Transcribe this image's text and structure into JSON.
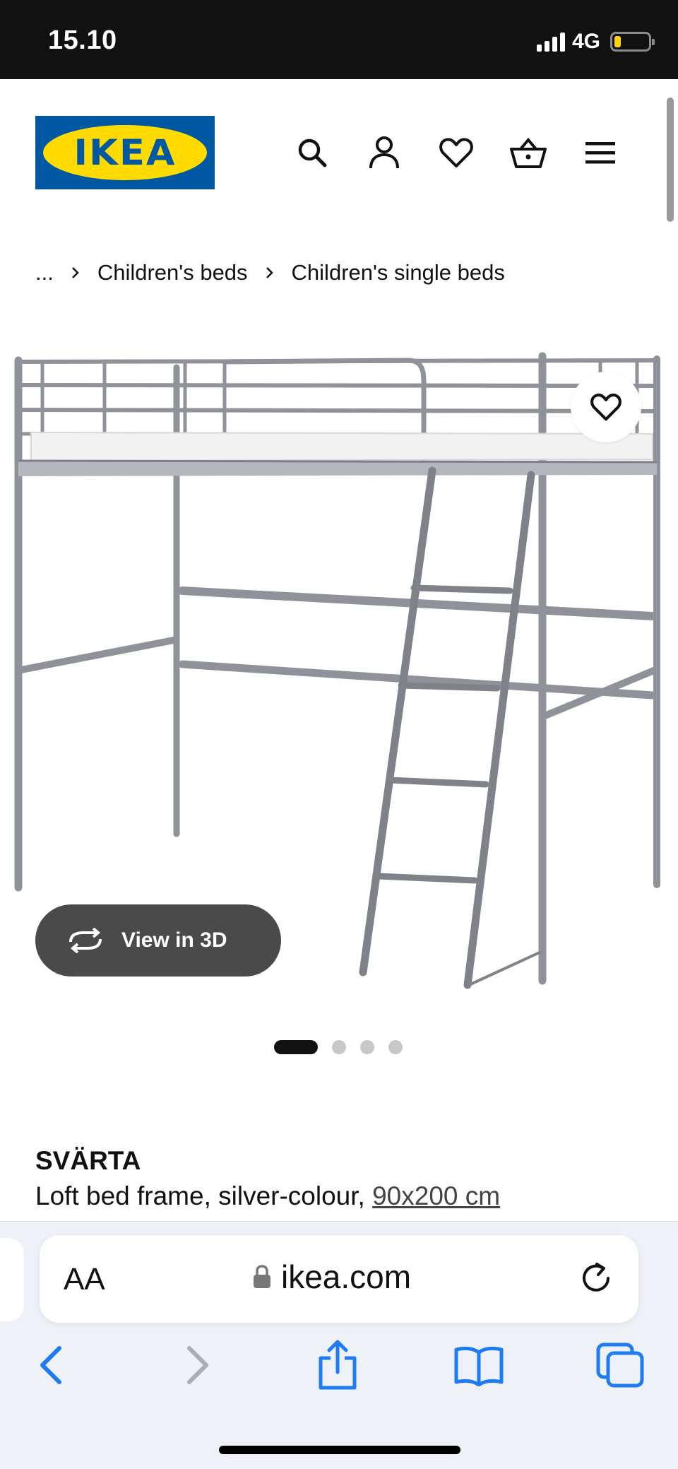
{
  "status_bar": {
    "time": "15.10",
    "network": "4G",
    "battery_level": 0.2
  },
  "brand": {
    "logo_text": "IKEA",
    "colors": {
      "blue": "#0058a3",
      "yellow": "#ffdb00"
    }
  },
  "header": {
    "icons": [
      "search-icon",
      "profile-icon",
      "heart-icon",
      "basket-icon",
      "menu-icon"
    ]
  },
  "breadcrumb": {
    "items": [
      "...",
      "Children's beds",
      "Children's single beds"
    ]
  },
  "product": {
    "name": "SVÄRTA",
    "description": "Loft bed frame, silver-colour, ",
    "size": "90x200 cm",
    "view_3d_label": "View in 3D",
    "carousel": {
      "total": 4,
      "active_index": 0
    }
  },
  "browser": {
    "text_size_label": "AA",
    "url": "ikea.com",
    "accent": "#1e7bf2"
  }
}
